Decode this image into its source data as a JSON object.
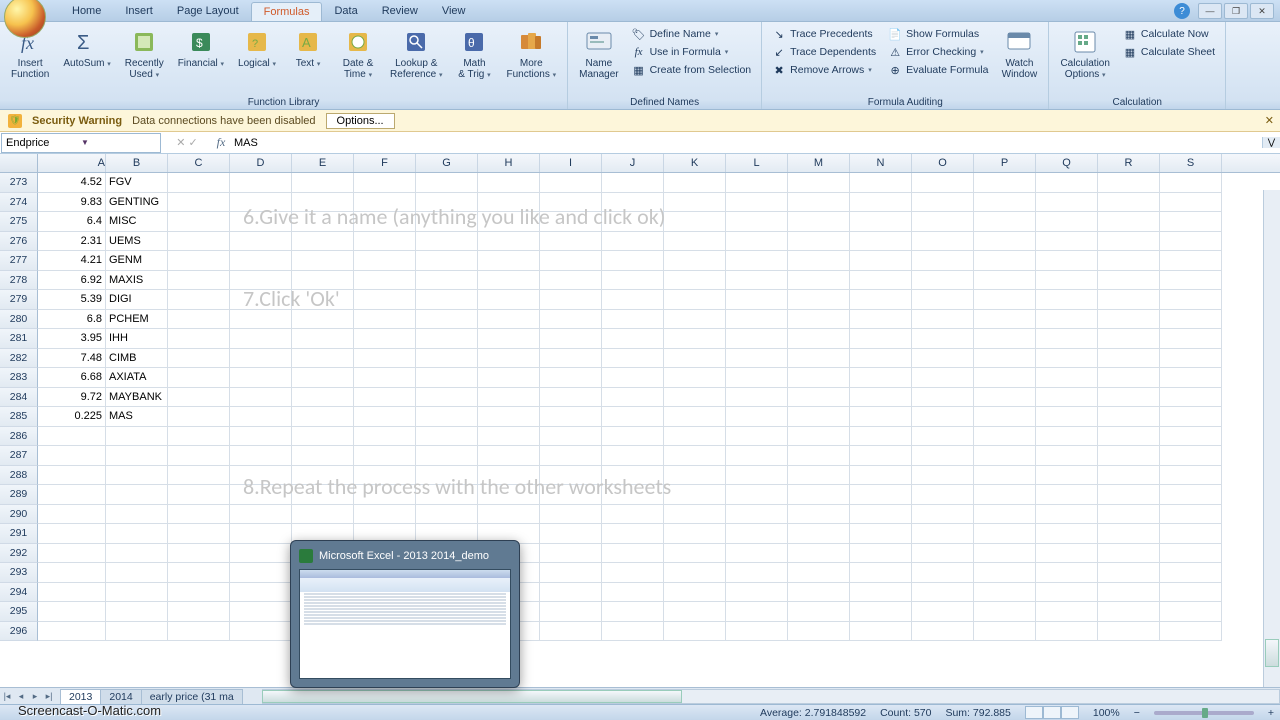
{
  "tabs": [
    "Home",
    "Insert",
    "Page Layout",
    "Formulas",
    "Data",
    "Review",
    "View"
  ],
  "active_tab": "Formulas",
  "ribbon": {
    "function_library": {
      "label": "Function Library",
      "insert_function": "Insert\nFunction",
      "autosum": "AutoSum",
      "recently_used": "Recently\nUsed",
      "financial": "Financial",
      "logical": "Logical",
      "text": "Text",
      "date_time": "Date &\nTime",
      "lookup_reference": "Lookup &\nReference",
      "math_trig": "Math\n& Trig",
      "more_functions": "More\nFunctions"
    },
    "defined_names": {
      "label": "Defined Names",
      "name_manager": "Name\nManager",
      "define_name": "Define Name",
      "use_in_formula": "Use in Formula",
      "create_from_selection": "Create from Selection"
    },
    "formula_auditing": {
      "label": "Formula Auditing",
      "trace_precedents": "Trace Precedents",
      "trace_dependents": "Trace Dependents",
      "remove_arrows": "Remove Arrows",
      "show_formulas": "Show Formulas",
      "error_checking": "Error Checking",
      "evaluate_formula": "Evaluate Formula",
      "watch_window": "Watch\nWindow"
    },
    "calculation": {
      "label": "Calculation",
      "calculation_options": "Calculation\nOptions",
      "calculate_now": "Calculate Now",
      "calculate_sheet": "Calculate Sheet"
    }
  },
  "security": {
    "title": "Security Warning",
    "msg": "Data connections have been disabled",
    "options": "Options..."
  },
  "namebox": "Endprice",
  "formula": "MAS",
  "columns": [
    "A",
    "B",
    "C",
    "D",
    "E",
    "F",
    "G",
    "H",
    "I",
    "J",
    "K",
    "L",
    "M",
    "N",
    "O",
    "P",
    "Q",
    "R",
    "S"
  ],
  "rows": [
    {
      "n": 273,
      "a": "4.52",
      "b": "FGV"
    },
    {
      "n": 274,
      "a": "9.83",
      "b": "GENTING"
    },
    {
      "n": 275,
      "a": "6.4",
      "b": "MISC"
    },
    {
      "n": 276,
      "a": "2.31",
      "b": "UEMS"
    },
    {
      "n": 277,
      "a": "4.21",
      "b": "GENM"
    },
    {
      "n": 278,
      "a": "6.92",
      "b": "MAXIS"
    },
    {
      "n": 279,
      "a": "5.39",
      "b": "DIGI"
    },
    {
      "n": 280,
      "a": "6.8",
      "b": "PCHEM"
    },
    {
      "n": 281,
      "a": "3.95",
      "b": "IHH"
    },
    {
      "n": 282,
      "a": "7.48",
      "b": "CIMB"
    },
    {
      "n": 283,
      "a": "6.68",
      "b": "AXIATA"
    },
    {
      "n": 284,
      "a": "9.72",
      "b": "MAYBANK"
    },
    {
      "n": 285,
      "a": "0.225",
      "b": "MAS"
    },
    {
      "n": 286
    },
    {
      "n": 287
    },
    {
      "n": 288
    },
    {
      "n": 289
    },
    {
      "n": 290
    },
    {
      "n": 291
    },
    {
      "n": 292
    },
    {
      "n": 293
    },
    {
      "n": 294
    },
    {
      "n": 295
    },
    {
      "n": 296
    }
  ],
  "ghost": {
    "l1": "6.Give it a name (anything you like and click ok)",
    "l2": "7.Click 'Ok'",
    "l3": "8.Repeat the process with the other worksheets"
  },
  "preview_title": "Microsoft Excel - 2013 2014_demo",
  "sheets": [
    "2013",
    "2014",
    "early price (31 ma"
  ],
  "status": {
    "average": "Average: 2.791848592",
    "count": "Count: 570",
    "sum": "Sum: 792.885",
    "zoom": "100%"
  },
  "watermark": "Screencast-O-Matic.com"
}
